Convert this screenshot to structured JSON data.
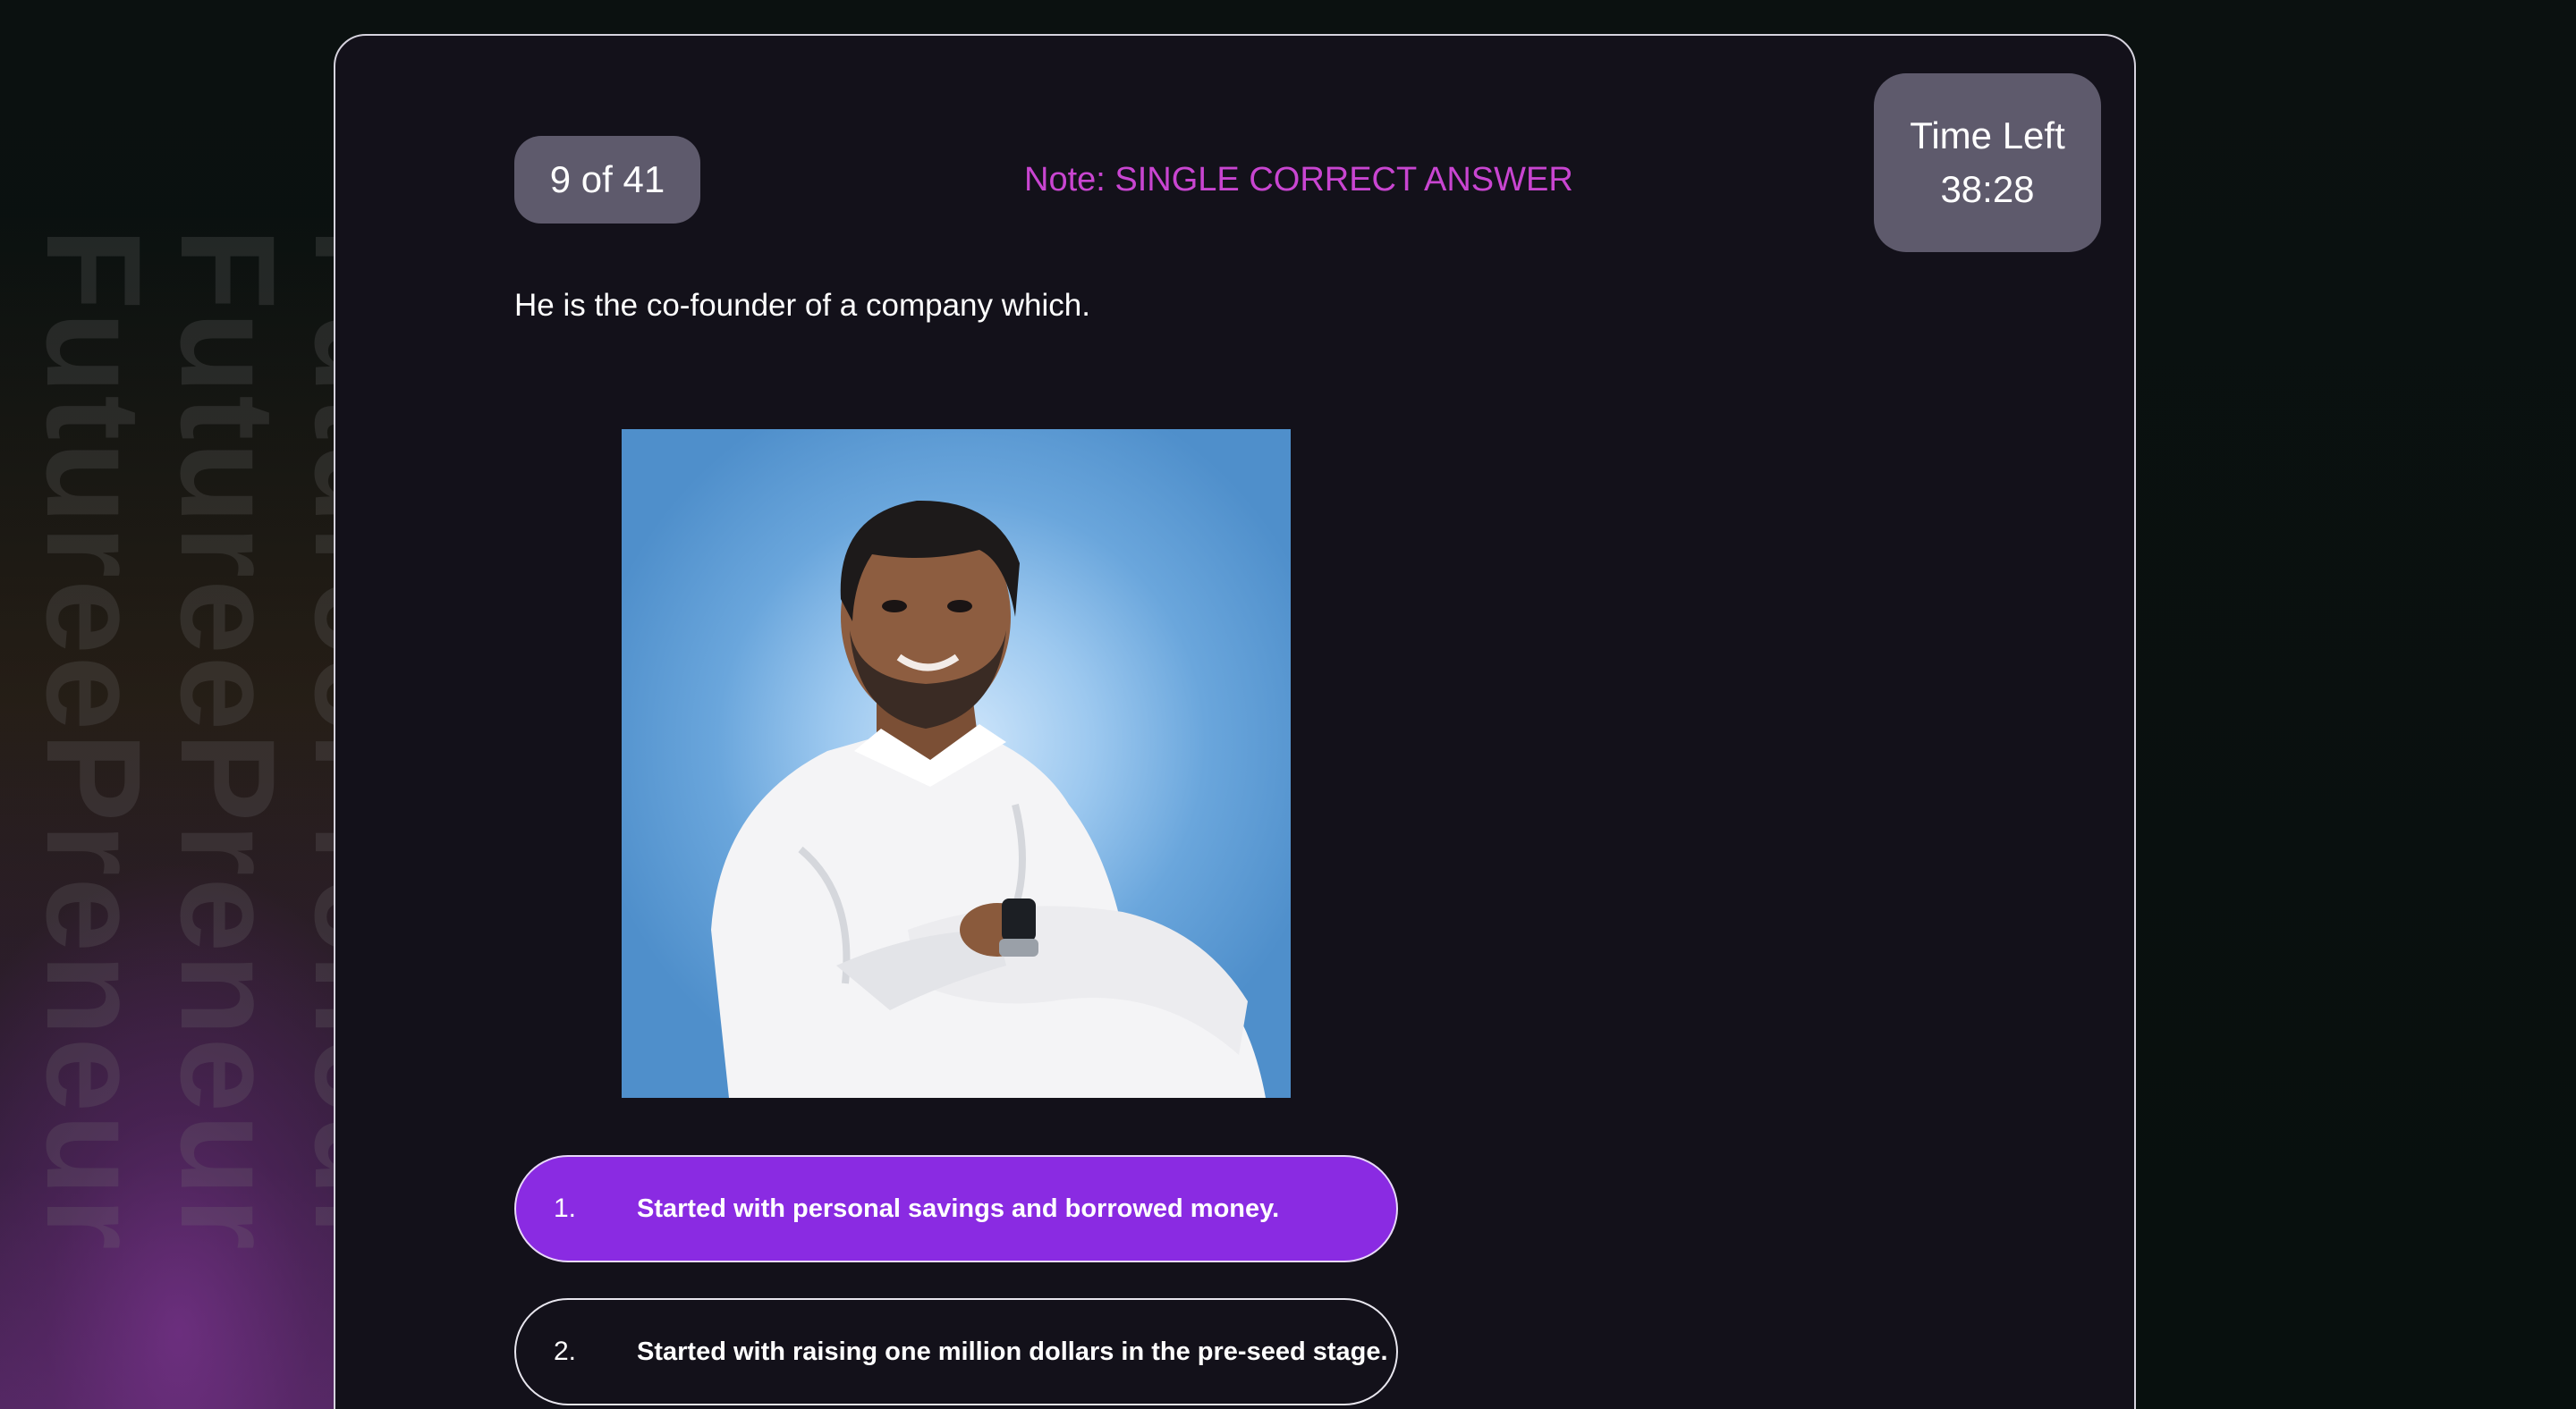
{
  "watermark": {
    "text": "FutureePreneur"
  },
  "quiz": {
    "counter": "9 of 41",
    "note": "Note: SINGLE CORRECT ANSWER",
    "timer": {
      "label": "Time Left",
      "value": "38:28"
    },
    "question": "He is the co-founder of a company which.",
    "options": [
      {
        "number": "1.",
        "text": "Started with personal savings and borrowed money.",
        "selected": true
      },
      {
        "number": "2.",
        "text": "Started with raising one million dollars in the pre-seed stage.",
        "selected": false
      }
    ]
  },
  "colors": {
    "accent": "#8a2be2",
    "note": "#c945d1",
    "card_bg": "#13111a",
    "pill_bg": "#5e5a6c"
  }
}
